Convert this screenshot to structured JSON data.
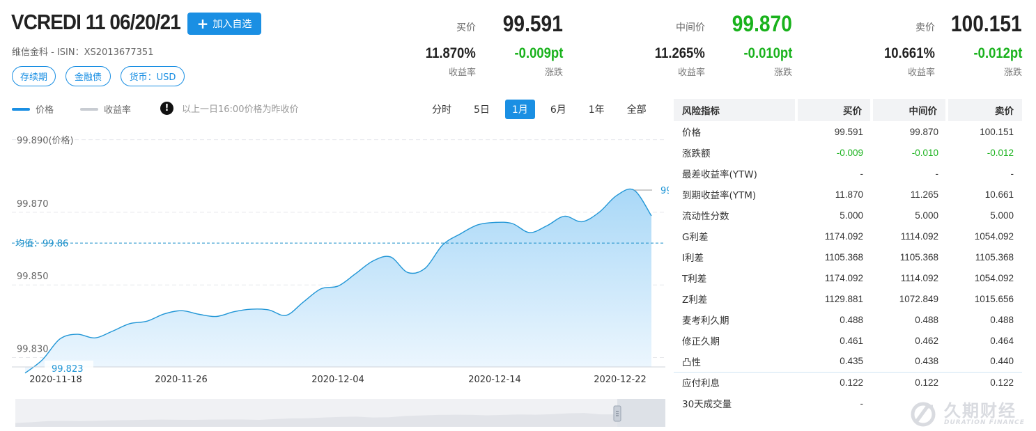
{
  "header": {
    "title": "VCREDI 11 06/20/21",
    "add_label": "加入自选",
    "subline": "维信金科 - ISIN：XS2013677351",
    "tags": [
      "存续期",
      "金融债",
      "货币：USD"
    ]
  },
  "quotes": {
    "bid": {
      "label": "买价",
      "price": "99.591",
      "yield": "11.870%",
      "yield_label": "收益率",
      "change": "-0.009pt",
      "change_label": "涨跌"
    },
    "mid": {
      "label": "中间价",
      "price": "99.870",
      "yield": "11.265%",
      "yield_label": "收益率",
      "change": "-0.010pt",
      "change_label": "涨跌"
    },
    "ask": {
      "label": "卖价",
      "price": "100.151",
      "yield": "10.661%",
      "yield_label": "收益率",
      "change": "-0.012pt",
      "change_label": "涨跌"
    }
  },
  "legend": {
    "price": "价格",
    "yield": "收益率",
    "note": "以上一日16:00价格为昨收价",
    "note_icon": "!"
  },
  "range_tabs": [
    "分时",
    "5日",
    "1月",
    "6月",
    "1年",
    "全部"
  ],
  "active_range": "1月",
  "chart_data": {
    "type": "area",
    "yaxis_title": "99.890(价格)",
    "y_ticks": [
      "99.870",
      "99.850",
      "99.830"
    ],
    "ylim": [
      99.8255,
      99.8905
    ],
    "x_tick_labels": [
      "2020-11-18",
      "2020-11-26",
      "2020-12-04",
      "2020-12-14",
      "2020-12-22"
    ],
    "series": [
      {
        "values": [
          99.8238,
          99.8275,
          99.8332,
          99.8345,
          99.8335,
          99.8353,
          99.8374,
          99.8381,
          99.8401,
          99.841,
          99.84,
          99.8394,
          99.8407,
          99.8414,
          99.8412,
          99.8397,
          99.8434,
          99.847,
          99.8478,
          99.8512,
          99.8547,
          99.8558,
          99.8515,
          99.8527,
          99.8591,
          99.8621,
          99.8646,
          99.8653,
          99.865,
          99.8625,
          99.8644,
          99.867,
          99.8655,
          99.8681,
          99.8727,
          99.8742,
          99.8671
        ]
      }
    ],
    "mean_label": "均值：",
    "mean_value": 99.86,
    "mean_text": "99.86",
    "min_label": "99.823",
    "max_label": "99",
    "colors": {
      "line": "#2196d6",
      "fill_top": "#a9d8f7",
      "fill_bottom": "#eef7fe",
      "mean": "#1a8fc9"
    }
  },
  "risk_table": {
    "headers": [
      "风险指标",
      "买价",
      "中间价",
      "卖价"
    ],
    "rows": [
      [
        "价格",
        "99.591",
        "99.870",
        "100.151"
      ],
      [
        "涨跌额",
        "-0.009",
        "-0.010",
        "-0.012"
      ],
      [
        "最差收益率(YTW)",
        "-",
        "-",
        "-"
      ],
      [
        "到期收益率(YTM)",
        "11.870",
        "11.265",
        "10.661"
      ],
      [
        "流动性分数",
        "5.000",
        "5.000",
        "5.000"
      ],
      [
        "G利差",
        "1174.092",
        "1114.092",
        "1054.092"
      ],
      [
        "I利差",
        "1105.368",
        "1105.368",
        "1105.368"
      ],
      [
        "T利差",
        "1174.092",
        "1114.092",
        "1054.092"
      ],
      [
        "Z利差",
        "1129.881",
        "1072.849",
        "1015.656"
      ],
      [
        "麦考利久期",
        "0.488",
        "0.488",
        "0.488"
      ],
      [
        "修正久期",
        "0.461",
        "0.462",
        "0.464"
      ],
      [
        "凸性",
        "0.435",
        "0.438",
        "0.440"
      ],
      [
        "应付利息",
        "0.122",
        "0.122",
        "0.122"
      ],
      [
        "30天成交量",
        "-",
        "",
        ""
      ]
    ]
  },
  "watermark": {
    "main": "久期财经",
    "sub": "DURATION FINANCE"
  }
}
